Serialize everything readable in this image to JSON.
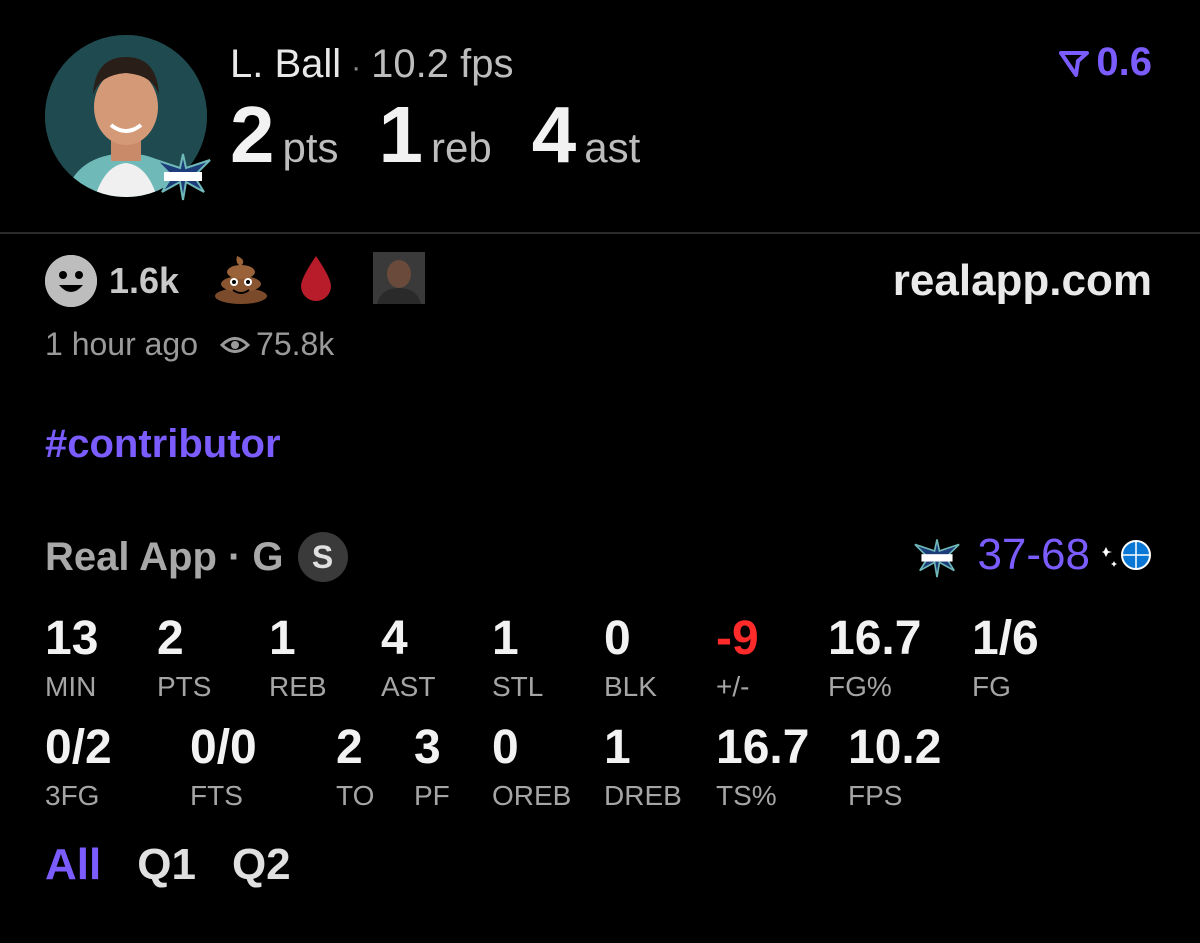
{
  "player": {
    "name": "L. Ball",
    "fps": "10.2 fps",
    "headline_stats": [
      {
        "value": "2",
        "unit": "pts"
      },
      {
        "value": "1",
        "unit": "reb"
      },
      {
        "value": "4",
        "unit": "ast"
      }
    ]
  },
  "rating": "0.6",
  "reactions": {
    "count": "1.6k",
    "time_ago": "1 hour ago",
    "views": "75.8k"
  },
  "site": "realapp.com",
  "hashtag": "#contributor",
  "game": {
    "label": "Real App · G",
    "badge": "S",
    "score": "37-68"
  },
  "stats_row1": [
    {
      "value": "13",
      "label": "MIN"
    },
    {
      "value": "2",
      "label": "PTS"
    },
    {
      "value": "1",
      "label": "REB"
    },
    {
      "value": "4",
      "label": "AST"
    },
    {
      "value": "1",
      "label": "STL"
    },
    {
      "value": "0",
      "label": "BLK"
    },
    {
      "value": "-9",
      "label": "+/-"
    },
    {
      "value": "16.7",
      "label": "FG%"
    },
    {
      "value": "1/6",
      "label": "FG"
    }
  ],
  "stats_row2": [
    {
      "value": "0/2",
      "label": "3FG"
    },
    {
      "value": "0/0",
      "label": "FTS"
    },
    {
      "value": "2",
      "label": "TO"
    },
    {
      "value": "3",
      "label": "PF"
    },
    {
      "value": "0",
      "label": "OREB"
    },
    {
      "value": "1",
      "label": "DREB"
    },
    {
      "value": "16.7",
      "label": "TS%"
    },
    {
      "value": "10.2",
      "label": "FPS"
    }
  ],
  "tabs": [
    "All",
    "Q1",
    "Q2"
  ],
  "colors": {
    "accent": "#7b5cff",
    "negative": "#ff2b2b",
    "background": "#000000"
  },
  "icons": [
    "player-avatar",
    "hornets-logo-icon",
    "rating-arrow-icon",
    "smiley-icon",
    "poop-emoji-icon",
    "blood-drop-icon",
    "user-avatar-icon",
    "eye-icon",
    "magic-logo-icon"
  ]
}
